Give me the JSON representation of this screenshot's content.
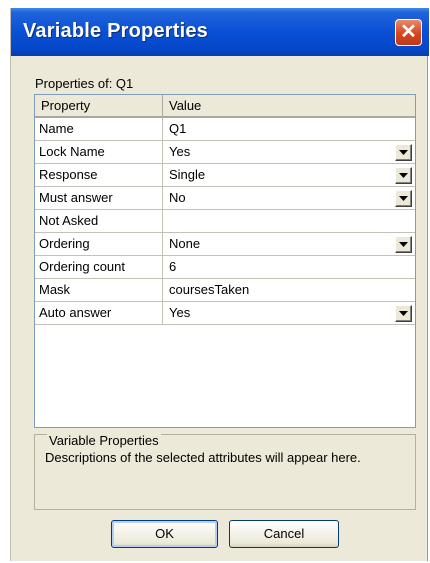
{
  "dialog": {
    "title": "Variable Properties",
    "close_glyph": "✕",
    "properties_of": "Properties of: Q1"
  },
  "grid": {
    "headers": [
      "Property",
      "Value"
    ],
    "rows": [
      {
        "property": "Name",
        "value": "Q1",
        "has_dropdown": false
      },
      {
        "property": "Lock Name",
        "value": "Yes",
        "has_dropdown": true
      },
      {
        "property": "Response",
        "value": "Single",
        "has_dropdown": true
      },
      {
        "property": "Must answer",
        "value": "No",
        "has_dropdown": true
      },
      {
        "property": "Not Asked",
        "value": "",
        "has_dropdown": false
      },
      {
        "property": "Ordering",
        "value": "None",
        "has_dropdown": true
      },
      {
        "property": "Ordering count",
        "value": "6",
        "has_dropdown": false
      },
      {
        "property": "Mask",
        "value": "coursesTaken",
        "has_dropdown": false
      },
      {
        "property": "Auto answer",
        "value": "Yes",
        "has_dropdown": true
      }
    ]
  },
  "description": {
    "title": "Variable Properties",
    "text": "Descriptions of the selected attributes will appear here."
  },
  "buttons": {
    "ok": "OK",
    "cancel": "Cancel"
  }
}
